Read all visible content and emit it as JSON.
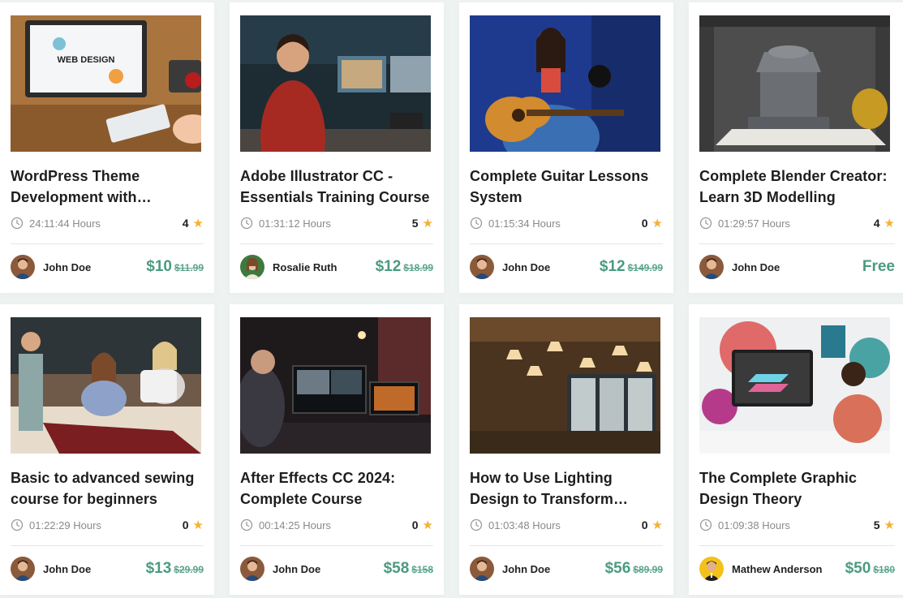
{
  "courses": [
    {
      "title": "WordPress Theme Development with…",
      "duration": "24:11:44 Hours",
      "rating": "4",
      "author": "John Doe",
      "price": "$10",
      "old_price": "$11.99",
      "image": "web-design-desk",
      "avatar": "john-doe"
    },
    {
      "title": "Adobe Illustrator CC - Essentials Training Course",
      "duration": "01:31:12 Hours",
      "rating": "5",
      "author": "Rosalie Ruth",
      "price": "$12",
      "old_price": "$18.99",
      "image": "video-studio-man",
      "avatar": "rosalie-ruth"
    },
    {
      "title": "Complete Guitar Lessons System",
      "duration": "01:15:34 Hours",
      "rating": "0",
      "author": "John Doe",
      "price": "$12",
      "old_price": "$149.99",
      "image": "guitar-girl",
      "avatar": "john-doe"
    },
    {
      "title": "Complete Blender Creator: Learn 3D Modelling",
      "duration": "01:29:57 Hours",
      "rating": "4",
      "author": "John Doe",
      "price": "Free",
      "old_price": "",
      "image": "blender-3d-model",
      "avatar": "john-doe"
    },
    {
      "title": "Basic to advanced sewing course for beginners",
      "duration": "01:22:29 Hours",
      "rating": "0",
      "author": "John Doe",
      "price": "$13",
      "old_price": "$29.99",
      "image": "sewing-class",
      "avatar": "john-doe"
    },
    {
      "title": "After Effects CC 2024: Complete Course",
      "duration": "00:14:25 Hours",
      "rating": "0",
      "author": "John Doe",
      "price": "$58",
      "old_price": "$158",
      "image": "video-editor-dark",
      "avatar": "john-doe"
    },
    {
      "title": "How to Use Lighting Design to Transform your…",
      "duration": "01:03:48 Hours",
      "rating": "0",
      "author": "John Doe",
      "price": "$56",
      "old_price": "$89.99",
      "image": "lighting-room",
      "avatar": "john-doe"
    },
    {
      "title": "The Complete Graphic Design Theory",
      "duration": "01:09:38 Hours",
      "rating": "5",
      "author": "Mathew Anderson",
      "price": "$50",
      "old_price": "$180",
      "image": "graphic-designer",
      "avatar": "mathew-anderson"
    }
  ],
  "colors": {
    "accent": "#4a9b7f",
    "star": "#f2b233",
    "text": "#1e1e1e",
    "muted": "#8a8a8a"
  }
}
